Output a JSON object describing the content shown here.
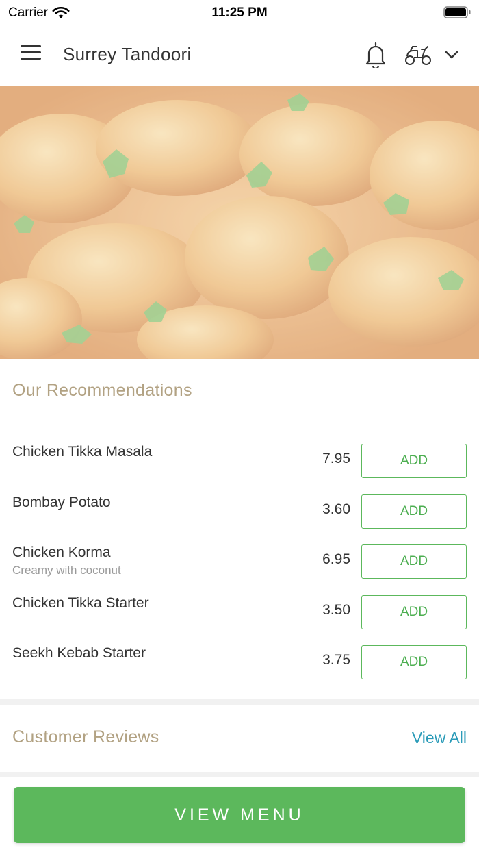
{
  "status_bar": {
    "carrier": "Carrier",
    "time": "11:25 PM"
  },
  "header": {
    "title": "Surrey Tandoori",
    "icons": [
      "menu-icon",
      "bell-icon",
      "scooter-icon",
      "chevron-down-icon"
    ]
  },
  "hero": {
    "image": "chicken-curry-photo"
  },
  "recommendations": {
    "title": "Our Recommendations",
    "add_label": "ADD",
    "items": [
      {
        "name": "Chicken Tikka Masala",
        "description": "",
        "price": "7.95"
      },
      {
        "name": "Bombay Potato",
        "description": "",
        "price": "3.60"
      },
      {
        "name": "Chicken Korma",
        "description": "Creamy with coconut",
        "price": "6.95"
      },
      {
        "name": "Chicken Tikka Starter",
        "description": "",
        "price": "3.50"
      },
      {
        "name": "Seekh Kebab Starter",
        "description": "",
        "price": "3.75"
      }
    ]
  },
  "reviews": {
    "title": "Customer Reviews",
    "view_all_label": "View All"
  },
  "cta": {
    "label": "VIEW MENU"
  },
  "colors": {
    "accent_green": "#5cb85c",
    "section_title": "#b2a283",
    "link_blue": "#2a9bb8"
  }
}
